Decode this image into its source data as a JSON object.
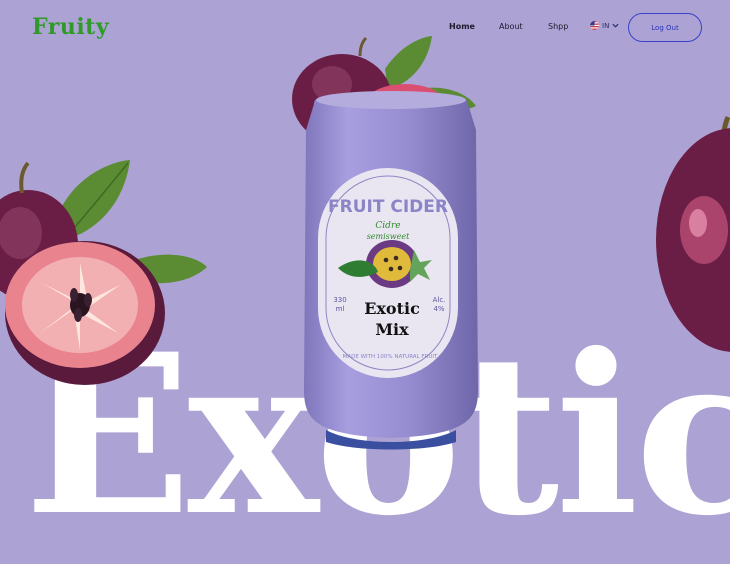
{
  "brand": {
    "name": "Fruity"
  },
  "nav": {
    "home": "Home",
    "about": "About",
    "shop": "Shpp"
  },
  "lang": {
    "code": "IN",
    "flag_icon": "us-flag-icon",
    "arrow_icon": "chevron-down-icon"
  },
  "auth": {
    "logout_label": "Log Out"
  },
  "hero": {
    "word": "Exotic",
    "can": {
      "brand": "FRUIT CIDER",
      "script": "Cidre",
      "script2": "semisweet",
      "volume": "330",
      "volume_unit": "ml",
      "alc": "Alc.",
      "alc_value": "4%",
      "name": "Exotic Mix",
      "footer": "MADE WITH 100% NATURAL FRUIT"
    }
  },
  "colors": {
    "background": "#aca3d4",
    "logo": "#2f9a27",
    "button_border": "#3a41c8",
    "can": "#9a90cf"
  }
}
